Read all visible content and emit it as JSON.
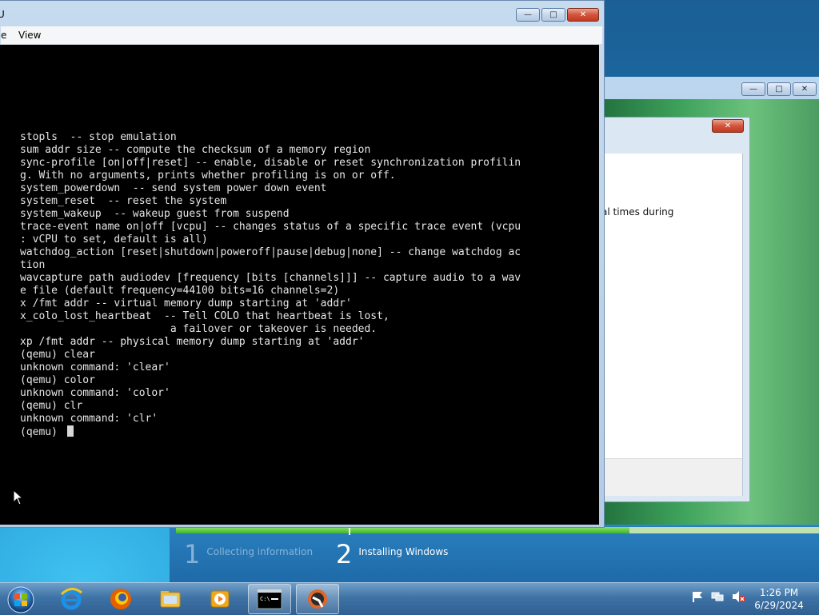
{
  "qemu_window": {
    "title": "U",
    "menu": [
      "e",
      "View"
    ],
    "controls": {
      "minimize": "—",
      "maximize": "□",
      "close": "✕"
    }
  },
  "console_lines": [
    "stopls  -- stop emulation",
    "sum addr size -- compute the checksum of a memory region",
    "sync-profile [on|off|reset] -- enable, disable or reset synchronization profilin",
    "g. With no arguments, prints whether profiling is on or off.",
    "system_powerdown  -- send system power down event",
    "system_reset  -- reset the system",
    "system_wakeup  -- wakeup guest from suspend",
    "trace-event name on|off [vcpu] -- changes status of a specific trace event (vcpu",
    ": vCPU to set, default is all)",
    "watchdog_action [reset|shutdown|poweroff|pause|debug|none] -- change watchdog ac",
    "tion",
    "wavcapture path audiodev [frequency [bits [channels]]] -- capture audio to a wav",
    "e file (default frequency=44100 bits=16 channels=2)",
    "x /fmt addr -- virtual memory dump starting at 'addr'",
    "x_colo_lost_heartbeat  -- Tell COLO that heartbeat is lost,",
    "                        a failover or takeover is needed.",
    "xp /fmt addr -- physical memory dump starting at 'addr'",
    "(qemu) clear",
    "unknown command: 'clear'",
    "(qemu) color",
    "unknown command: 'color'",
    "(qemu) clr",
    "unknown command: 'clr'"
  ],
  "console_prompt": "(qemu) ",
  "setup_window": {
    "controls": {
      "minimize": "—",
      "maximize": "□",
      "close": "✕"
    },
    "dialog_text": "al times during"
  },
  "install_progress": {
    "fraction": 0.705,
    "steps": [
      {
        "number": "1",
        "label": "Collecting information",
        "state": "done"
      },
      {
        "number": "2",
        "label": "Installing Windows",
        "state": "current"
      }
    ]
  },
  "taskbar": {
    "pinned": [
      "internet-explorer-icon",
      "firefox-icon",
      "file-explorer-icon",
      "media-player-icon",
      "command-prompt-icon",
      "qemu-icon"
    ],
    "clock_time": "1:26 PM",
    "clock_date": "6/29/2024"
  },
  "colors": {
    "console_bg": "#000000",
    "console_fg": "#e6e6e6",
    "progress_green": "#3fb52a"
  }
}
